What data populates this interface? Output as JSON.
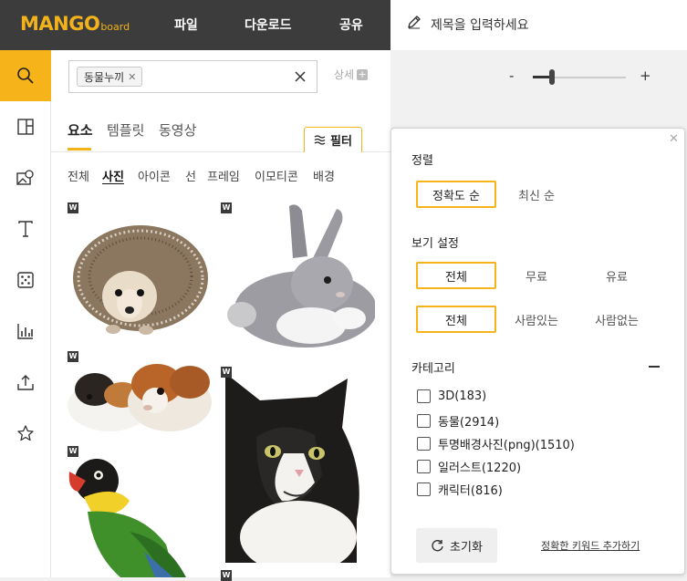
{
  "brand": {
    "logo_main": "MANGO",
    "logo_sub": "board",
    "color": "#f2b21b"
  },
  "topmenu": [
    "파일",
    "다운로드",
    "공유"
  ],
  "document": {
    "title_placeholder": "제목을 입력하세요"
  },
  "leftrail": [
    {
      "icon": "search-icon",
      "active": true
    },
    {
      "icon": "template-icon"
    },
    {
      "icon": "image-icon"
    },
    {
      "icon": "text-icon"
    },
    {
      "icon": "element-icon"
    },
    {
      "icon": "chart-icon"
    },
    {
      "icon": "upload-icon"
    },
    {
      "icon": "star-icon"
    }
  ],
  "search": {
    "chip_label": "동물누끼",
    "detail_label": "상세"
  },
  "tabs": [
    "요소",
    "템플릿",
    "동영상"
  ],
  "filter_label": "필터",
  "subtabs": [
    "전체",
    "사진",
    "아이콘",
    "선",
    "프레임",
    "이모티콘",
    "배경"
  ],
  "thumbnails": [
    {
      "subject": "hedgehog",
      "badge": "W"
    },
    {
      "subject": "rabbit",
      "badge": "W"
    },
    {
      "subject": "guinea-pigs",
      "badge": "W"
    },
    {
      "subject": "cat",
      "badge": "W"
    },
    {
      "subject": "parrot",
      "badge": "W"
    }
  ],
  "zoom": {
    "minus": "-",
    "plus": "+",
    "level": 0.2
  },
  "filter_popup": {
    "sort_title": "정렬",
    "sort_options": [
      "정확도 순",
      "최신 순"
    ],
    "sort_selected": 0,
    "view_title": "보기 설정",
    "price_options": [
      "전체",
      "무료",
      "유료"
    ],
    "people_options": [
      "전체",
      "사람있는",
      "사람없는"
    ],
    "category_title": "카테고리",
    "categories": [
      "3D(183)",
      "동물(2914)",
      "투명배경사진(png)(1510)",
      "일러스트(1220)",
      "캐릭터(816)"
    ],
    "reset_label": "초기화",
    "keyword_link": "정확한 키워드 추가하기"
  },
  "accent_color": "#f6b31a"
}
